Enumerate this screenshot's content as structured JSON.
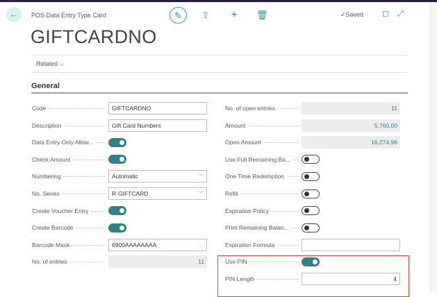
{
  "header": {
    "breadcrumb": "POS Data Entry Type Card",
    "saved": "✓Saved",
    "title": "GIFTCARDNO"
  },
  "menu": {
    "related": "Related ⌵"
  },
  "section": {
    "title": "General"
  },
  "left": [
    {
      "label": "Code",
      "type": "text",
      "value": "GIFTCARDNO"
    },
    {
      "label": "Description",
      "type": "text",
      "value": "Gift Card Numbers"
    },
    {
      "label": "Data Entry Only Allow...",
      "type": "toggle",
      "value": true
    },
    {
      "label": "Check Amount",
      "type": "toggle",
      "value": true
    },
    {
      "label": "Numbering",
      "type": "select",
      "value": "Automatic"
    },
    {
      "label": "No. Series",
      "type": "select",
      "value": "R-GIFTCARD"
    },
    {
      "label": "Create Voucher Entry",
      "type": "toggle",
      "value": true
    },
    {
      "label": "Create Barcode",
      "type": "toggle",
      "value": true
    },
    {
      "label": "Barcode Mask",
      "type": "lookup",
      "value": "6900AAAAAAAA"
    },
    {
      "label": "No. of entries",
      "type": "readonly",
      "value": "11"
    }
  ],
  "right": [
    {
      "label": "No. of open entries",
      "type": "readonly",
      "value": "11"
    },
    {
      "label": "Amount",
      "type": "readonly",
      "value": "5,760.00"
    },
    {
      "label": "Open Amount",
      "type": "readonly",
      "value": "16,274.96"
    },
    {
      "label": "Use Full Remaining Ba...",
      "type": "toggle",
      "value": false
    },
    {
      "label": "One Time Redemption",
      "type": "toggle",
      "value": false
    },
    {
      "label": "Refill",
      "type": "toggle",
      "value": false
    },
    {
      "label": "Expiration Policy",
      "type": "toggle",
      "value": false
    },
    {
      "label": "Print Remaining Balan...",
      "type": "toggle",
      "value": false
    },
    {
      "label": "Expiration Formula",
      "type": "text",
      "value": ""
    },
    {
      "label": "Use PIN",
      "type": "toggle",
      "value": true
    },
    {
      "label": "PIN Length",
      "type": "number",
      "value": "4"
    }
  ],
  "colors": {
    "accent": "#2b8289",
    "highlight": "#e04040"
  }
}
